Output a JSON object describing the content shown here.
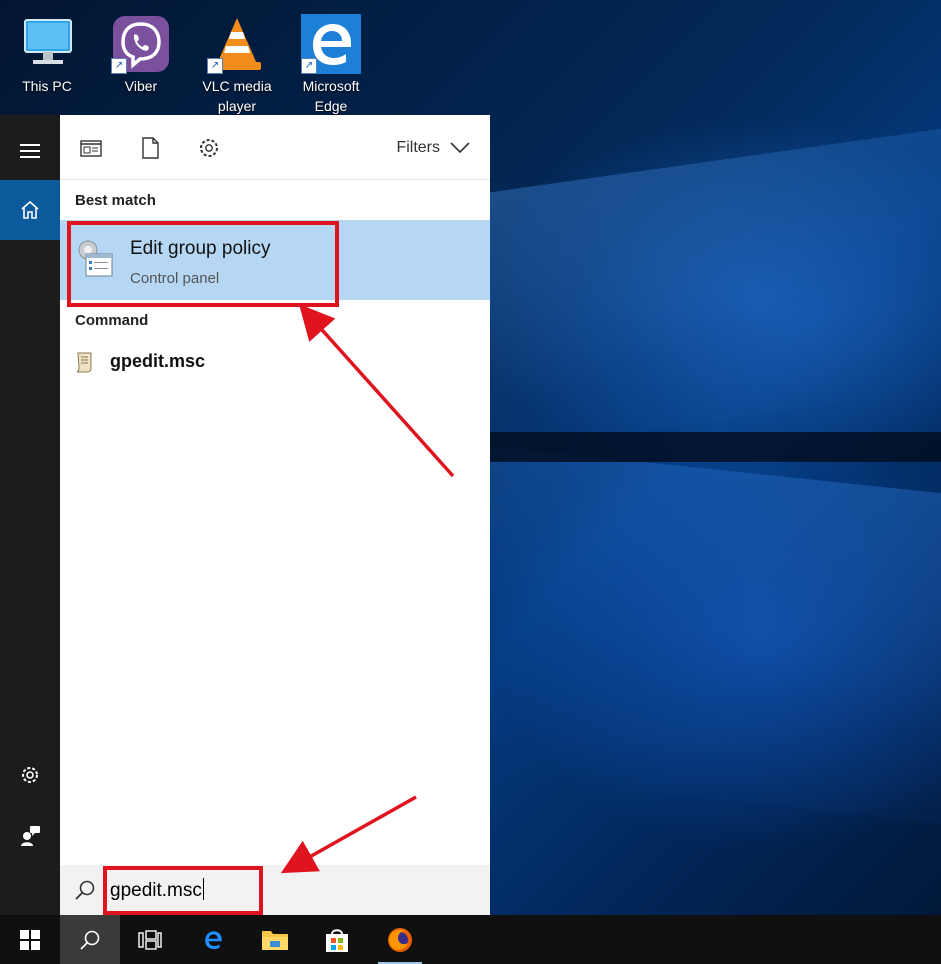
{
  "desktop": {
    "icons": [
      {
        "label": "This PC",
        "icon": "computer-icon"
      },
      {
        "label": "Viber",
        "icon": "viber-icon"
      },
      {
        "label": "VLC media player",
        "icon": "vlc-icon"
      },
      {
        "label": "Microsoft Edge",
        "icon": "edge-icon"
      }
    ]
  },
  "rail": {
    "items": [
      {
        "name": "hamburger-menu",
        "icon": "hamburger-icon"
      },
      {
        "name": "home",
        "icon": "home-icon"
      },
      {
        "name": "settings",
        "icon": "gear-icon"
      },
      {
        "name": "feedback",
        "icon": "feedback-icon"
      }
    ]
  },
  "toolbar": {
    "filters_label": "Filters"
  },
  "results": {
    "best_match_heading": "Best match",
    "best_match": {
      "title": "Edit group policy",
      "subtitle": "Control panel"
    },
    "command_heading": "Command",
    "command": {
      "title": "gpedit.msc"
    }
  },
  "search": {
    "value": "gpedit.msc"
  },
  "taskbar": {
    "items": [
      "windows-start",
      "search",
      "task-view",
      "edge",
      "file-explorer",
      "store",
      "firefox"
    ]
  },
  "colors": {
    "highlight": "#b5d7f3",
    "annotation_red": "#e0141e",
    "rail_active": "#0a5a9c"
  }
}
